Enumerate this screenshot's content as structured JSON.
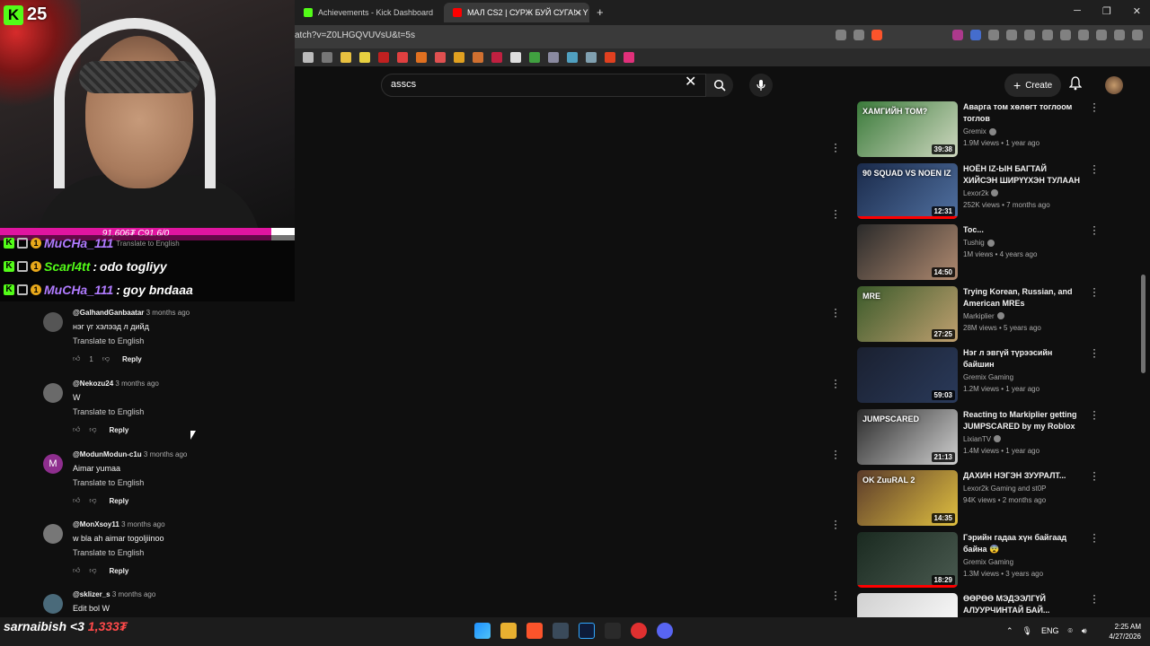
{
  "stream": {
    "viewer_count": "25",
    "bar_text": "91,606₮ C91.6/0",
    "chat": [
      {
        "user": "MuCHa_111",
        "message": "Translate to English"
      },
      {
        "user": "Scarl4tt",
        "message": "odo togliyy"
      },
      {
        "user": "MuCHa_111",
        "message": "goy bndaaa"
      }
    ],
    "subscriber": "sarnaibish <3 ",
    "subscriber_amount": "1,333₮"
  },
  "browser": {
    "tabs": [
      {
        "label": "Achievements - Kick Dashboard",
        "color": "#53fc18"
      },
      {
        "label": "МАЛ CS2 | СУРЖ БУЙ СУГА! - Y",
        "color": "#ff0000"
      }
    ],
    "url": "atch?v=Z0LHGQVUVsU&t=5s"
  },
  "youtube": {
    "search_value": "asscs",
    "create_label": "Create",
    "comments": [
      {
        "author": "@GalhandGanbaatar",
        "time": "3 months ago",
        "text": "нэг үг хэлээд л дийд",
        "translate": "Translate to English",
        "likes": "1",
        "reply": "Reply"
      },
      {
        "author": "@Nekozu24",
        "time": "3 months ago",
        "text": "W",
        "translate": "Translate to English",
        "likes": "",
        "reply": "Reply"
      },
      {
        "author": "@ModunModun-c1u",
        "time": "3 months ago",
        "text": "Aimar yumaa",
        "translate": "Translate to English",
        "likes": "",
        "reply": "Reply",
        "initial": "M"
      },
      {
        "author": "@MonXsoy11",
        "time": "3 months ago",
        "text": "w bla ah  aimar togoljiinoo",
        "translate": "Translate to English",
        "likes": "",
        "reply": "Reply"
      },
      {
        "author": "@sklizer_s",
        "time": "3 months ago",
        "text": "Edit bol W",
        "translate": "",
        "likes": "",
        "reply": ""
      }
    ],
    "recommendations": [
      {
        "title": "Аварга том хөлөгт тоглоом тоглов",
        "channel": "Gremix",
        "verified": true,
        "views": "1.9M views",
        "age": "1 year ago",
        "duration": "39:38",
        "thumb": [
          "#3a7a3a",
          "#cfd8c0"
        ],
        "thumb_text": "ХАМГИЙН ТОМ?",
        "watched": 0
      },
      {
        "title": "НОЁН IZ-ЫН БАГТАЙ ХИЙСЭН ШИРҮҮХЭН ТУЛААН",
        "channel": "Lexor2k",
        "verified": true,
        "views": "252K views",
        "age": "7 months ago",
        "duration": "12:31",
        "thumb": [
          "#1a2a4a",
          "#5070a0"
        ],
        "thumb_text": "90 SQUAD VS NOEN IZ",
        "watched": 1
      },
      {
        "title": "Toc...",
        "channel": "Tushig",
        "verified": true,
        "views": "1M views",
        "age": "4 years ago",
        "duration": "14:50",
        "thumb": [
          "#2a2a2a",
          "#b08a70"
        ],
        "thumb_text": "",
        "watched": 0
      },
      {
        "title": "Trying Korean, Russian, and American MREs",
        "channel": "Markiplier",
        "verified": true,
        "views": "28M views",
        "age": "5 years ago",
        "duration": "27:25",
        "thumb": [
          "#3a5a2a",
          "#c0a070"
        ],
        "thumb_text": "MRE",
        "watched": 0
      },
      {
        "title": "Нэг л эвгүй түрээсийн байшин",
        "channel": "Gremix Gaming",
        "verified": false,
        "views": "1.2M views",
        "age": "1 year ago",
        "duration": "59:03",
        "thumb": [
          "#1a2030",
          "#2a3a5a"
        ],
        "thumb_text": "",
        "watched": 0
      },
      {
        "title": "Reacting to Markiplier getting JUMPSCARED by my Roblox ...",
        "channel": "LixianTV",
        "verified": true,
        "views": "1.4M views",
        "age": "1 year ago",
        "duration": "21:13",
        "thumb": [
          "#2a2a2a",
          "#d0d0d0"
        ],
        "thumb_text": "JUMPSCARED",
        "watched": 0
      },
      {
        "title": "ДАХИН НЭГЭН ЗУУРАЛТ...",
        "channel": "Lexor2k Gaming and st0P",
        "verified": false,
        "views": "94K views",
        "age": "2 months ago",
        "duration": "14:35",
        "thumb": [
          "#5a3a2a",
          "#e0c040"
        ],
        "thumb_text": "OK ZuuRAL 2",
        "watched": 0
      },
      {
        "title": "Гэрийн гадаа хүн байгаад байна 😨",
        "channel": "Gremix Gaming",
        "verified": false,
        "views": "1.3M views",
        "age": "3 years ago",
        "duration": "18:29",
        "thumb": [
          "#1a2a20",
          "#4a5a50"
        ],
        "thumb_text": "",
        "watched": 1
      },
      {
        "title": "ӨӨРӨӨ МЭДЭЭЛГҮЙ АЛУУРЧИНТАЙ БАЙ...",
        "channel": "",
        "verified": false,
        "views": "",
        "age": "",
        "duration": "",
        "thumb": [
          "#d0d0d0",
          "#ffffff"
        ],
        "thumb_text": "",
        "watched": 0
      }
    ]
  },
  "taskbar": {
    "lang": "ENG",
    "time": "2:25 AM",
    "date": "4/27/2026"
  }
}
